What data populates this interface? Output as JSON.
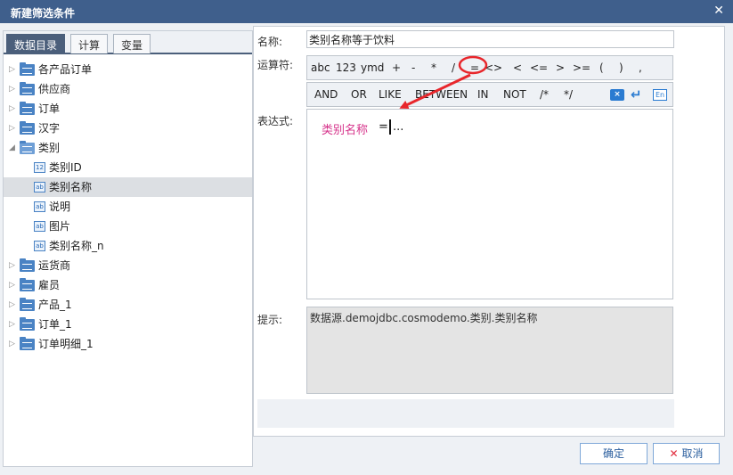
{
  "dialog": {
    "title": "新建筛选条件",
    "close": "✕"
  },
  "tabs": [
    {
      "label": "数据目录",
      "active": true
    },
    {
      "label": "计算",
      "active": false
    },
    {
      "label": "变量",
      "active": false
    }
  ],
  "tree": [
    {
      "label": "各产品订单",
      "type": "folder"
    },
    {
      "label": "供应商",
      "type": "folder"
    },
    {
      "label": "订单",
      "type": "folder"
    },
    {
      "label": "汉字",
      "type": "folder"
    },
    {
      "label": "类别",
      "type": "folder-open",
      "children": [
        {
          "label": "类别ID",
          "icon": "12"
        },
        {
          "label": "类别名称",
          "icon": "ab",
          "selected": true
        },
        {
          "label": "说明",
          "icon": "ab"
        },
        {
          "label": "图片",
          "icon": "ab"
        },
        {
          "label": "类别名称_n",
          "icon": "ab"
        }
      ]
    },
    {
      "label": "运货商",
      "type": "folder"
    },
    {
      "label": "雇员",
      "type": "folder"
    },
    {
      "label": "产品_1",
      "type": "folder"
    },
    {
      "label": "订单_1",
      "type": "folder"
    },
    {
      "label": "订单明细_1",
      "type": "folder"
    }
  ],
  "form": {
    "name_label": "名称:",
    "name_value": "类别名称等于饮料",
    "operator_label": "运算符:",
    "expr_label": "表达式:",
    "hint_label": "提示:",
    "hint_text": "数据源.demojdbc.cosmodemo.类别.类别名称"
  },
  "operators_row1": [
    "abc",
    "123",
    "ymd",
    "+",
    "-",
    "*",
    "/",
    "=",
    "<>",
    "<",
    "<=",
    ">",
    ">=",
    "(",
    ")",
    ","
  ],
  "operators_row2": [
    "AND",
    "OR",
    "LIKE",
    "BETWEEN",
    "IN",
    "NOT",
    "/*",
    "*/"
  ],
  "expression": {
    "field": "类别名称",
    "operator": "=",
    "tail": "..."
  },
  "buttons": {
    "ok": "确定",
    "cancel": "取消"
  },
  "colors": {
    "titlebar": "#3f5f8c",
    "field": "#d6338b",
    "annotation": "#e8262b",
    "accent": "#2a7bd1"
  }
}
